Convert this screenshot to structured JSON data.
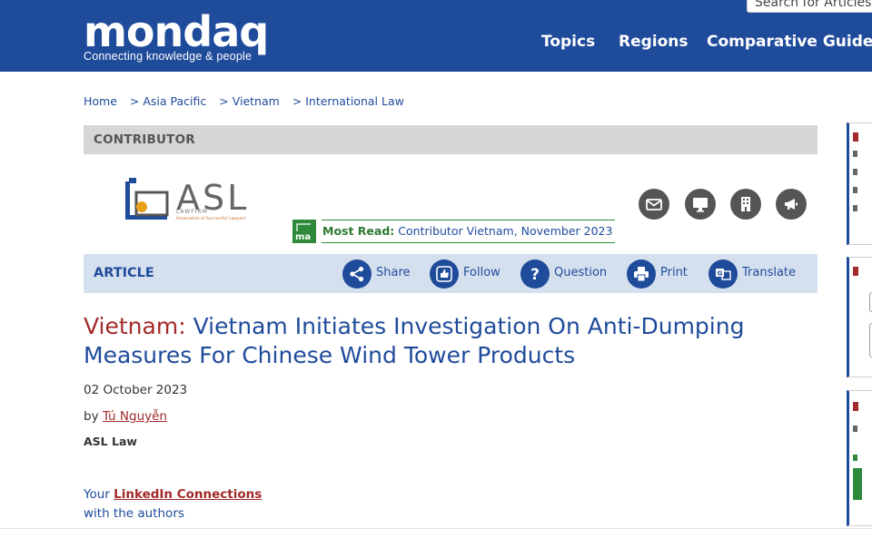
{
  "header": {
    "logo_word": "mondaq",
    "logo_tagline": "Connecting knowledge & people",
    "search_placeholder": "Search for Articles",
    "nav": [
      "Topics",
      "Regions",
      "Comparative Guides"
    ]
  },
  "breadcrumb": [
    "Home",
    "> Asia Pacific",
    "> Vietnam",
    "> International Law"
  ],
  "contributor": {
    "section_label": "CONTRIBUTOR",
    "firm_logo_text": "ASL",
    "firm_logo_small": "LAWFIRM",
    "firm_logo_tagline": "Association of Successful Lawyers",
    "most_read_badge": "ma",
    "most_read_label": "Most Read:",
    "most_read_text": "Contributor Vietnam, November 2023",
    "icons": [
      "email-icon",
      "desktop-icon",
      "building-icon",
      "megaphone-icon"
    ]
  },
  "article_bar": {
    "label": "ARTICLE",
    "actions": [
      {
        "icon": "share-icon",
        "label": "Share"
      },
      {
        "icon": "follow-icon",
        "label": "Follow"
      },
      {
        "icon": "question-icon",
        "label": "Question"
      },
      {
        "icon": "print-icon",
        "label": "Print"
      },
      {
        "icon": "translate-icon",
        "label": "Translate"
      }
    ]
  },
  "article": {
    "country": "Vietnam:",
    "title": "Vietnam Initiates Investigation On Anti-Dumping Measures For Chinese Wind Tower Products",
    "date": "02 October 2023",
    "by": "by",
    "author": "Tú Nguyễn",
    "firm": "ASL Law",
    "linkedin_prefix": "Your",
    "linkedin_link": "LinkedIn Connections",
    "linkedin_suffix": "with the authors"
  },
  "colors": {
    "brand_blue": "#1f4b9b",
    "accent_red": "#a32a2a",
    "green": "#2e8a3a"
  }
}
